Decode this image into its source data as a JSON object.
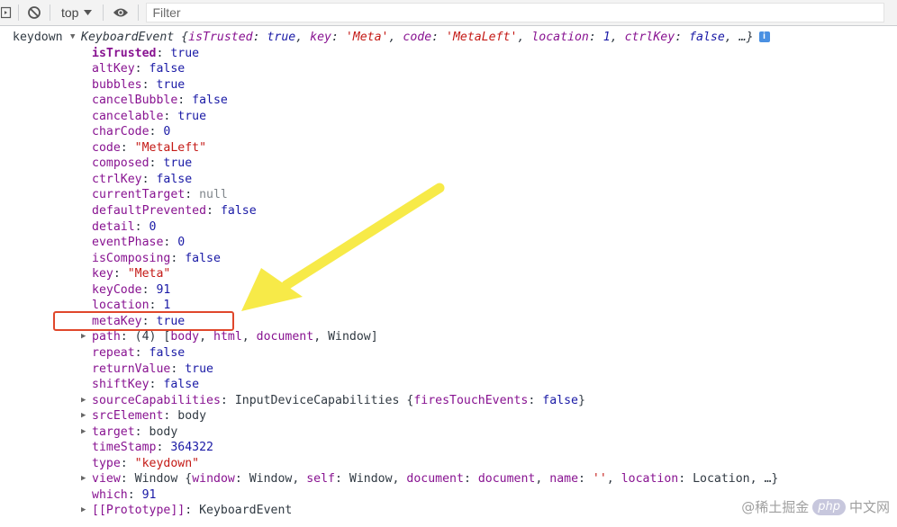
{
  "toolbar": {
    "context_label": "top",
    "filter_placeholder": "Filter"
  },
  "log": {
    "event_type": "keydown",
    "summary": {
      "class_name": "KeyboardEvent",
      "open": "{",
      "items": [
        {
          "key": "isTrusted",
          "value": "true",
          "vtype": "bool"
        },
        {
          "key": "key",
          "value": "'Meta'",
          "vtype": "str"
        },
        {
          "key": "code",
          "value": "'MetaLeft'",
          "vtype": "str"
        },
        {
          "key": "location",
          "value": "1",
          "vtype": "num"
        },
        {
          "key": "ctrlKey",
          "value": "false",
          "vtype": "bool"
        }
      ],
      "close": ", …}",
      "info_badge": "i"
    },
    "properties": [
      {
        "key": "isTrusted",
        "value": "true",
        "vtype": "bool",
        "own": true,
        "expandable": false
      },
      {
        "key": "altKey",
        "value": "false",
        "vtype": "bool",
        "expandable": false
      },
      {
        "key": "bubbles",
        "value": "true",
        "vtype": "bool",
        "expandable": false
      },
      {
        "key": "cancelBubble",
        "value": "false",
        "vtype": "bool",
        "expandable": false
      },
      {
        "key": "cancelable",
        "value": "true",
        "vtype": "bool",
        "expandable": false
      },
      {
        "key": "charCode",
        "value": "0",
        "vtype": "num",
        "expandable": false
      },
      {
        "key": "code",
        "value": "\"MetaLeft\"",
        "vtype": "str",
        "expandable": false
      },
      {
        "key": "composed",
        "value": "true",
        "vtype": "bool",
        "expandable": false
      },
      {
        "key": "ctrlKey",
        "value": "false",
        "vtype": "bool",
        "expandable": false
      },
      {
        "key": "currentTarget",
        "value": "null",
        "vtype": "null",
        "expandable": false
      },
      {
        "key": "defaultPrevented",
        "value": "false",
        "vtype": "bool",
        "expandable": false
      },
      {
        "key": "detail",
        "value": "0",
        "vtype": "num",
        "expandable": false
      },
      {
        "key": "eventPhase",
        "value": "0",
        "vtype": "num",
        "expandable": false
      },
      {
        "key": "isComposing",
        "value": "false",
        "vtype": "bool",
        "expandable": false
      },
      {
        "key": "key",
        "value": "\"Meta\"",
        "vtype": "str",
        "expandable": false
      },
      {
        "key": "keyCode",
        "value": "91",
        "vtype": "num",
        "expandable": false
      },
      {
        "key": "location",
        "value": "1",
        "vtype": "num",
        "expandable": false
      },
      {
        "key": "metaKey",
        "value": "true",
        "vtype": "bool",
        "expandable": false,
        "highlighted": true
      },
      {
        "key": "path",
        "value": "(4) [body, html, document, Window]",
        "vtype": "obj",
        "expandable": true,
        "segments": [
          {
            "t": "(4) [",
            "c": "vobj"
          },
          {
            "t": "body",
            "c": "k"
          },
          {
            "t": ", ",
            "c": "vobj"
          },
          {
            "t": "html",
            "c": "k"
          },
          {
            "t": ", ",
            "c": "vobj"
          },
          {
            "t": "document",
            "c": "k"
          },
          {
            "t": ", Window]",
            "c": "vobj"
          }
        ]
      },
      {
        "key": "repeat",
        "value": "false",
        "vtype": "bool",
        "expandable": false
      },
      {
        "key": "returnValue",
        "value": "true",
        "vtype": "bool",
        "expandable": false
      },
      {
        "key": "shiftKey",
        "value": "false",
        "vtype": "bool",
        "expandable": false
      },
      {
        "key": "sourceCapabilities",
        "value": "InputDeviceCapabilities {firesTouchEvents: false}",
        "vtype": "obj",
        "expandable": true,
        "segments": [
          {
            "t": "InputDeviceCapabilities {",
            "c": "vobj"
          },
          {
            "t": "firesTouchEvents",
            "c": "k"
          },
          {
            "t": ": ",
            "c": "vobj"
          },
          {
            "t": "false",
            "c": "vbool"
          },
          {
            "t": "}",
            "c": "vobj"
          }
        ]
      },
      {
        "key": "srcElement",
        "value": "body",
        "vtype": "obj",
        "expandable": true
      },
      {
        "key": "target",
        "value": "body",
        "vtype": "obj",
        "expandable": true
      },
      {
        "key": "timeStamp",
        "value": "364322",
        "vtype": "num",
        "expandable": false
      },
      {
        "key": "type",
        "value": "\"keydown\"",
        "vtype": "str",
        "expandable": false
      },
      {
        "key": "view",
        "value": "Window {window: Window, self: Window, document: document, name: '', location: Location, …}",
        "vtype": "obj",
        "expandable": true,
        "segments": [
          {
            "t": "Window {",
            "c": "vobj"
          },
          {
            "t": "window",
            "c": "k"
          },
          {
            "t": ": Window, ",
            "c": "vobj"
          },
          {
            "t": "self",
            "c": "k"
          },
          {
            "t": ": Window, ",
            "c": "vobj"
          },
          {
            "t": "document",
            "c": "k"
          },
          {
            "t": ": ",
            "c": "vobj"
          },
          {
            "t": "document",
            "c": "k"
          },
          {
            "t": ", ",
            "c": "vobj"
          },
          {
            "t": "name",
            "c": "k"
          },
          {
            "t": ": ",
            "c": "vobj"
          },
          {
            "t": "''",
            "c": "vstr"
          },
          {
            "t": ", ",
            "c": "vobj"
          },
          {
            "t": "location",
            "c": "k"
          },
          {
            "t": ": Location, …}",
            "c": "vobj"
          }
        ]
      },
      {
        "key": "which",
        "value": "91",
        "vtype": "num",
        "expandable": false
      },
      {
        "key": "[[Prototype]]",
        "value": "KeyboardEvent",
        "vtype": "obj",
        "expandable": true
      }
    ]
  },
  "watermark": {
    "text_left": "@稀土掘金",
    "logo_text": "php",
    "text_right": "中文网"
  },
  "colors": {
    "highlight_border": "#e0472b",
    "annotation_arrow": "#f7ea48",
    "property_key": "#881391",
    "string_value": "#c41a16",
    "number_value": "#1a1aa6"
  }
}
